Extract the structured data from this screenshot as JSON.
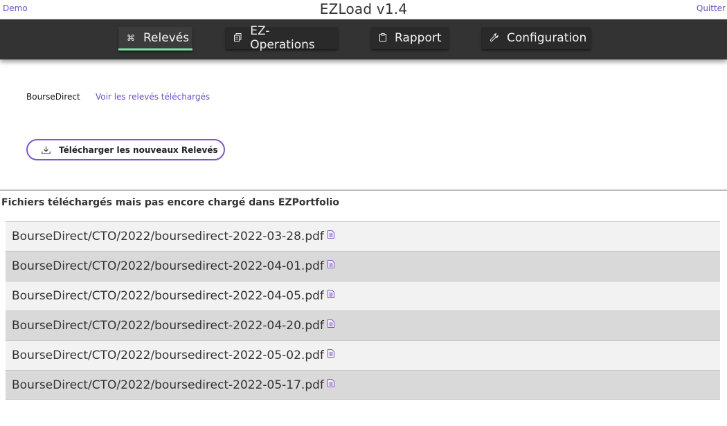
{
  "header": {
    "title": "EZLoad v1.4",
    "left_link": "Demo",
    "right_link": "Quitter"
  },
  "nav": {
    "active_index": 0,
    "tabs": [
      {
        "label": "Relevés",
        "icon": "command-icon",
        "glyph": "⌘"
      },
      {
        "label": "EZ-Operations",
        "icon": "page-icon",
        "glyph": "🗐"
      },
      {
        "label": "Rapport",
        "icon": "clipboard-icon",
        "glyph": "📋"
      },
      {
        "label": "Configuration",
        "icon": "wrench-icon",
        "glyph": "🔧"
      }
    ]
  },
  "main": {
    "broker": "BourseDirect",
    "view_link": "Voir les relevés téléchargés",
    "download_button": "Télécharger les nouveaux Relevés",
    "section_title": "Fichiers téléchargés mais pas encore chargé dans EZPortfolio",
    "files": [
      "BourseDirect/CTO/2022/boursedirect-2022-03-28.pdf",
      "BourseDirect/CTO/2022/boursedirect-2022-04-01.pdf",
      "BourseDirect/CTO/2022/boursedirect-2022-04-05.pdf",
      "BourseDirect/CTO/2022/boursedirect-2022-04-20.pdf",
      "BourseDirect/CTO/2022/boursedirect-2022-05-02.pdf",
      "BourseDirect/CTO/2022/boursedirect-2022-05-17.pdf"
    ]
  },
  "colors": {
    "accent": "#6a4fc7",
    "navbar": "#333333",
    "active_underline": "#7be3a8",
    "row_light": "#f2f2f2",
    "row_dark": "#d9d9d9"
  }
}
